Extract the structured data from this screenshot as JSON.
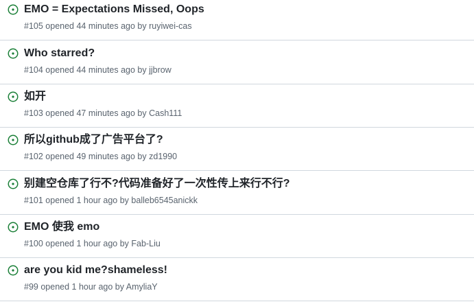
{
  "icons": {
    "open_issue": "issue-opened-icon",
    "open_issue_color": "#1a7f37"
  },
  "issues": [
    {
      "title": "EMO = Expectations Missed, Oops",
      "number": "#105",
      "opened": "opened 44 minutes ago by",
      "author": "ruyiwei-cas"
    },
    {
      "title": "Who starred?",
      "number": "#104",
      "opened": "opened 44 minutes ago by",
      "author": "jjbrow"
    },
    {
      "title": "如开",
      "number": "#103",
      "opened": "opened 47 minutes ago by",
      "author": "Cash111"
    },
    {
      "title": "所以github成了广告平台了?",
      "number": "#102",
      "opened": "opened 49 minutes ago by",
      "author": "zd1990"
    },
    {
      "title": "别建空仓库了行不?代码准备好了一次性传上来行不行?",
      "number": "#101",
      "opened": "opened 1 hour ago by",
      "author": "balleb6545anickk"
    },
    {
      "title": "EMO 使我 emo",
      "number": "#100",
      "opened": "opened 1 hour ago by",
      "author": "Fab-Liu"
    },
    {
      "title": "are you kid me?shameless!",
      "number": "#99",
      "opened": "opened 1 hour ago by",
      "author": "AmyliaY"
    }
  ]
}
